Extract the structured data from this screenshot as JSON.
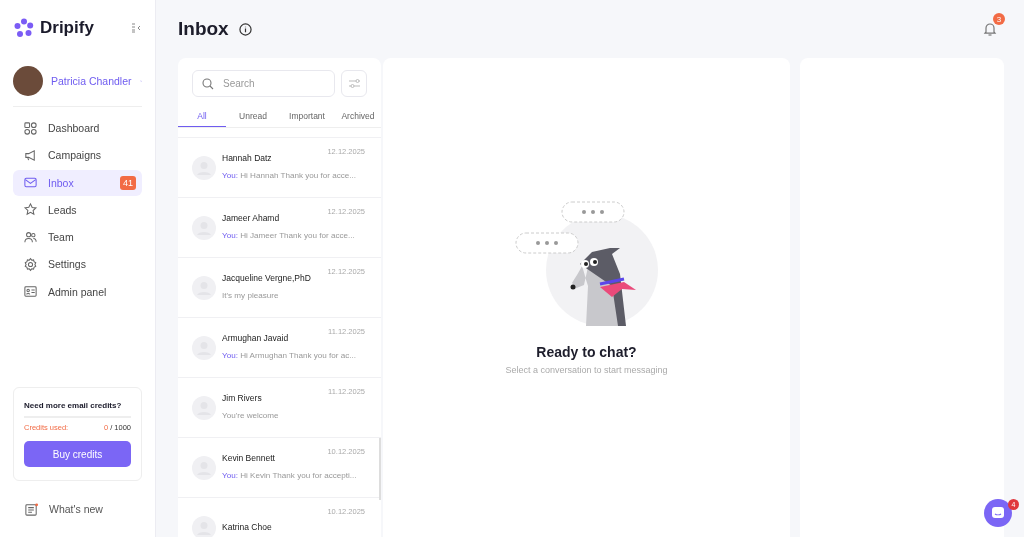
{
  "brand": {
    "name": "Dripify"
  },
  "user": {
    "name": "Patricia Chandler"
  },
  "nav": [
    {
      "label": "Dashboard",
      "kind": "dashboard",
      "selected": false
    },
    {
      "label": "Campaigns",
      "kind": "megaphone",
      "selected": false
    },
    {
      "label": "Inbox",
      "kind": "mail",
      "selected": true,
      "badge": "41"
    },
    {
      "label": "Leads",
      "kind": "star",
      "selected": false
    },
    {
      "label": "Team",
      "kind": "people",
      "selected": false
    },
    {
      "label": "Settings",
      "kind": "gear",
      "selected": false
    },
    {
      "label": "Admin panel",
      "kind": "idcard",
      "selected": false
    }
  ],
  "credits": {
    "title": "Need more email credits?",
    "label": "Credits used:",
    "used": "0",
    "total": "/ 1000",
    "level": 0,
    "button": "Buy credits"
  },
  "whats_new": {
    "label": "What's new"
  },
  "page": {
    "title": "Inbox",
    "notifications": "3"
  },
  "search": {
    "placeholder": "Search"
  },
  "tabs": [
    {
      "label": "All",
      "selected": true
    },
    {
      "label": "Unread",
      "selected": false
    },
    {
      "label": "Important",
      "selected": false
    },
    {
      "label": "Archived",
      "selected": false
    }
  ],
  "conversations": [
    {
      "name": "Hannah Datz",
      "date": "12.12.2025",
      "sender": "You:",
      "preview": "Hi Hannah Thank you for acce..."
    },
    {
      "name": "Jameer Ahamd",
      "date": "12.12.2025",
      "sender": "You:",
      "preview": "Hi Jameer Thank you for acce..."
    },
    {
      "name": "Jacqueline Vergne,PhD",
      "date": "12.12.2025",
      "preview": "It's my pleasure"
    },
    {
      "name": "Armughan Javaid",
      "date": "11.12.2025",
      "sender": "You:",
      "preview": "Hi Armughan Thank you for ac..."
    },
    {
      "name": "Jim Rivers",
      "date": "11.12.2025",
      "preview": "You're welcome"
    },
    {
      "name": "Kevin Bennett",
      "date": "10.12.2025",
      "sender": "You:",
      "preview": "Hi Kevin Thank you for accepti..."
    },
    {
      "name": "Katrina Choe",
      "date": "10.12.2025"
    }
  ],
  "empty_state": {
    "title": "Ready to chat?",
    "subtitle": "Select a conversation to start messaging"
  },
  "chat_widget": {
    "badge": "4"
  }
}
